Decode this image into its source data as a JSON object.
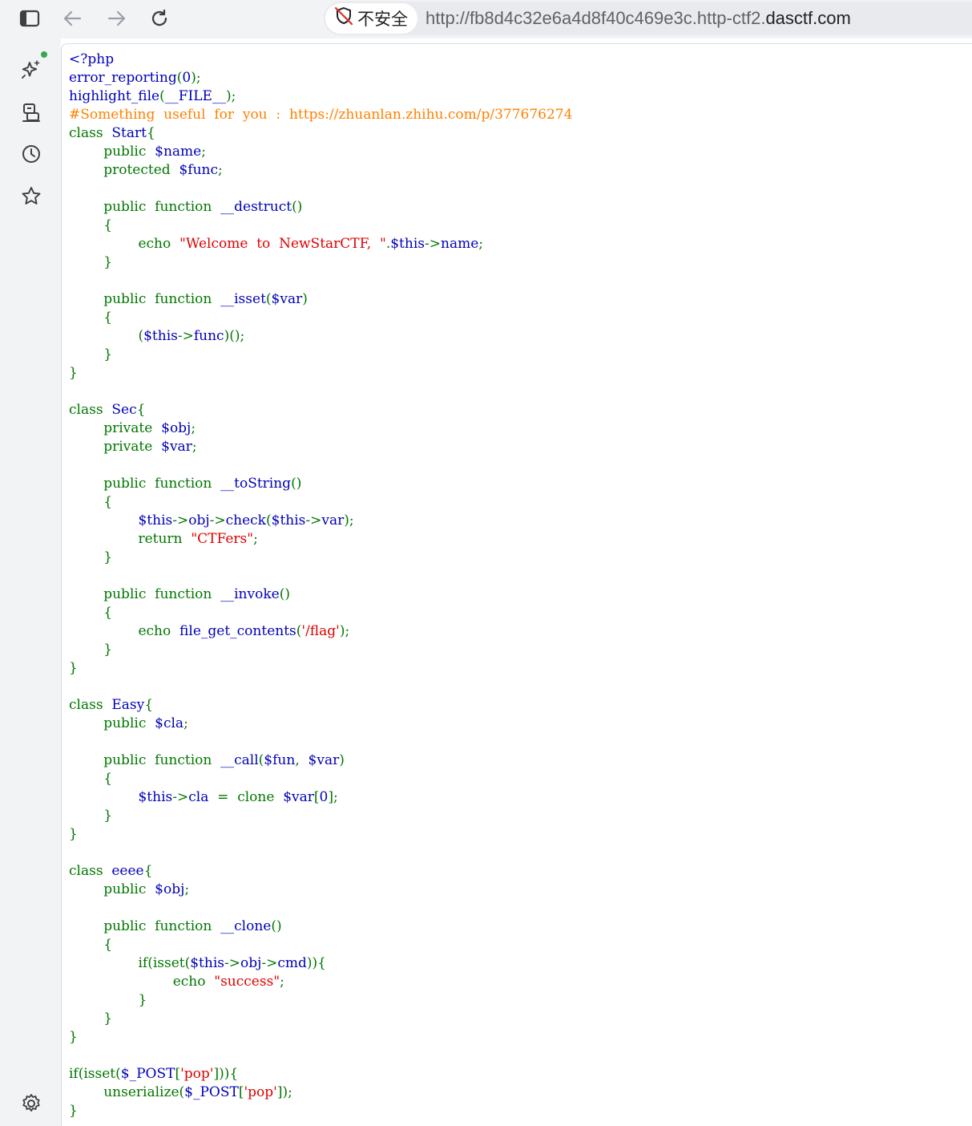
{
  "browser": {
    "security_label": "不安全",
    "url_prefix": "http://fb8d4c32e6a4d8f40c469e3c.http-ctf2.",
    "url_domain": "dasctf.com",
    "icons": [
      "sidebar-toggle-icon",
      "back-arrow-icon",
      "forward-arrow-icon",
      "reload-icon",
      "not-secure-shield-icon"
    ]
  },
  "sidebar": {
    "items": [
      {
        "name": "ai-sparkle-icon"
      },
      {
        "name": "extension-device-icon"
      },
      {
        "name": "history-clock-icon"
      },
      {
        "name": "favorites-star-icon"
      },
      {
        "name": "settings-gear-icon"
      }
    ],
    "badge_color": "#34a853"
  },
  "colors": {
    "default": "#0000BB",
    "keyword": "#007700",
    "string": "#DD0000",
    "comment": "#FF8000"
  },
  "code_lines": [
    [
      [
        "default",
        "<?php"
      ]
    ],
    [
      [
        "default",
        "error_reporting"
      ],
      [
        "keyword",
        "("
      ],
      [
        "default",
        "0"
      ],
      [
        "keyword",
        ");"
      ]
    ],
    [
      [
        "default",
        "highlight_file"
      ],
      [
        "keyword",
        "("
      ],
      [
        "default",
        "__FILE__"
      ],
      [
        "keyword",
        ");"
      ]
    ],
    [
      [
        "comment",
        "#Something  useful  for  you  :  https://zhuanlan.zhihu.com/p/377676274"
      ]
    ],
    [
      [
        "keyword",
        "class  "
      ],
      [
        "default",
        "Start"
      ],
      [
        "keyword",
        "{"
      ]
    ],
    [
      [
        "keyword",
        "        public  "
      ],
      [
        "default",
        "$name"
      ],
      [
        "keyword",
        ";"
      ]
    ],
    [
      [
        "keyword",
        "        protected  "
      ],
      [
        "default",
        "$func"
      ],
      [
        "keyword",
        ";"
      ]
    ],
    [],
    [
      [
        "keyword",
        "        public  function  "
      ],
      [
        "default",
        "__destruct"
      ],
      [
        "keyword",
        "()"
      ]
    ],
    [
      [
        "keyword",
        "        {"
      ]
    ],
    [
      [
        "keyword",
        "                echo  "
      ],
      [
        "string",
        "\"Welcome  to  NewStarCTF,  \""
      ],
      [
        "keyword",
        "."
      ],
      [
        "default",
        "$this"
      ],
      [
        "keyword",
        "->"
      ],
      [
        "default",
        "name"
      ],
      [
        "keyword",
        ";"
      ]
    ],
    [
      [
        "keyword",
        "        }"
      ]
    ],
    [],
    [
      [
        "keyword",
        "        public  function  "
      ],
      [
        "default",
        "__isset"
      ],
      [
        "keyword",
        "("
      ],
      [
        "default",
        "$var"
      ],
      [
        "keyword",
        ")"
      ]
    ],
    [
      [
        "keyword",
        "        {"
      ]
    ],
    [
      [
        "keyword",
        "                ("
      ],
      [
        "default",
        "$this"
      ],
      [
        "keyword",
        "->"
      ],
      [
        "default",
        "func"
      ],
      [
        "keyword",
        ")();"
      ]
    ],
    [
      [
        "keyword",
        "        }"
      ]
    ],
    [
      [
        "keyword",
        "}"
      ]
    ],
    [],
    [
      [
        "keyword",
        "class  "
      ],
      [
        "default",
        "Sec"
      ],
      [
        "keyword",
        "{"
      ]
    ],
    [
      [
        "keyword",
        "        private  "
      ],
      [
        "default",
        "$obj"
      ],
      [
        "keyword",
        ";"
      ]
    ],
    [
      [
        "keyword",
        "        private  "
      ],
      [
        "default",
        "$var"
      ],
      [
        "keyword",
        ";"
      ]
    ],
    [],
    [
      [
        "keyword",
        "        public  function  "
      ],
      [
        "default",
        "__toString"
      ],
      [
        "keyword",
        "()"
      ]
    ],
    [
      [
        "keyword",
        "        {"
      ]
    ],
    [
      [
        "keyword",
        "                "
      ],
      [
        "default",
        "$this"
      ],
      [
        "keyword",
        "->"
      ],
      [
        "default",
        "obj"
      ],
      [
        "keyword",
        "->"
      ],
      [
        "default",
        "check"
      ],
      [
        "keyword",
        "("
      ],
      [
        "default",
        "$this"
      ],
      [
        "keyword",
        "->"
      ],
      [
        "default",
        "var"
      ],
      [
        "keyword",
        ");"
      ]
    ],
    [
      [
        "keyword",
        "                return  "
      ],
      [
        "string",
        "\"CTFers\""
      ],
      [
        "keyword",
        ";"
      ]
    ],
    [
      [
        "keyword",
        "        }"
      ]
    ],
    [],
    [
      [
        "keyword",
        "        public  function  "
      ],
      [
        "default",
        "__invoke"
      ],
      [
        "keyword",
        "()"
      ]
    ],
    [
      [
        "keyword",
        "        {"
      ]
    ],
    [
      [
        "keyword",
        "                echo  "
      ],
      [
        "default",
        "file_get_contents"
      ],
      [
        "keyword",
        "("
      ],
      [
        "string",
        "'/flag'"
      ],
      [
        "keyword",
        ");"
      ]
    ],
    [
      [
        "keyword",
        "        }"
      ]
    ],
    [
      [
        "keyword",
        "}"
      ]
    ],
    [],
    [
      [
        "keyword",
        "class  "
      ],
      [
        "default",
        "Easy"
      ],
      [
        "keyword",
        "{"
      ]
    ],
    [
      [
        "keyword",
        "        public  "
      ],
      [
        "default",
        "$cla"
      ],
      [
        "keyword",
        ";"
      ]
    ],
    [],
    [
      [
        "keyword",
        "        public  function  "
      ],
      [
        "default",
        "__call"
      ],
      [
        "keyword",
        "("
      ],
      [
        "default",
        "$fun"
      ],
      [
        "keyword",
        ",  "
      ],
      [
        "default",
        "$var"
      ],
      [
        "keyword",
        ")"
      ]
    ],
    [
      [
        "keyword",
        "        {"
      ]
    ],
    [
      [
        "keyword",
        "                "
      ],
      [
        "default",
        "$this"
      ],
      [
        "keyword",
        "->"
      ],
      [
        "default",
        "cla  "
      ],
      [
        "keyword",
        "=  clone  "
      ],
      [
        "default",
        "$var"
      ],
      [
        "keyword",
        "["
      ],
      [
        "default",
        "0"
      ],
      [
        "keyword",
        "];"
      ]
    ],
    [
      [
        "keyword",
        "        }"
      ]
    ],
    [
      [
        "keyword",
        "}"
      ]
    ],
    [],
    [
      [
        "keyword",
        "class  "
      ],
      [
        "default",
        "eeee"
      ],
      [
        "keyword",
        "{"
      ]
    ],
    [
      [
        "keyword",
        "        public  "
      ],
      [
        "default",
        "$obj"
      ],
      [
        "keyword",
        ";"
      ]
    ],
    [],
    [
      [
        "keyword",
        "        public  function  "
      ],
      [
        "default",
        "__clone"
      ],
      [
        "keyword",
        "()"
      ]
    ],
    [
      [
        "keyword",
        "        {"
      ]
    ],
    [
      [
        "keyword",
        "                if(isset("
      ],
      [
        "default",
        "$this"
      ],
      [
        "keyword",
        "->"
      ],
      [
        "default",
        "obj"
      ],
      [
        "keyword",
        "->"
      ],
      [
        "default",
        "cmd"
      ],
      [
        "keyword",
        ")){"
      ]
    ],
    [
      [
        "keyword",
        "                        echo  "
      ],
      [
        "string",
        "\"success\""
      ],
      [
        "keyword",
        ";"
      ]
    ],
    [
      [
        "keyword",
        "                }"
      ]
    ],
    [
      [
        "keyword",
        "        }"
      ]
    ],
    [
      [
        "keyword",
        "}"
      ]
    ],
    [],
    [
      [
        "keyword",
        "if(isset("
      ],
      [
        "default",
        "$_POST"
      ],
      [
        "keyword",
        "["
      ],
      [
        "string",
        "'pop'"
      ],
      [
        "keyword",
        "])){"
      ]
    ],
    [
      [
        "keyword",
        "        unserialize("
      ],
      [
        "default",
        "$_POST"
      ],
      [
        "keyword",
        "["
      ],
      [
        "string",
        "'pop'"
      ],
      [
        "keyword",
        "]);"
      ]
    ],
    [
      [
        "keyword",
        "}"
      ]
    ]
  ]
}
